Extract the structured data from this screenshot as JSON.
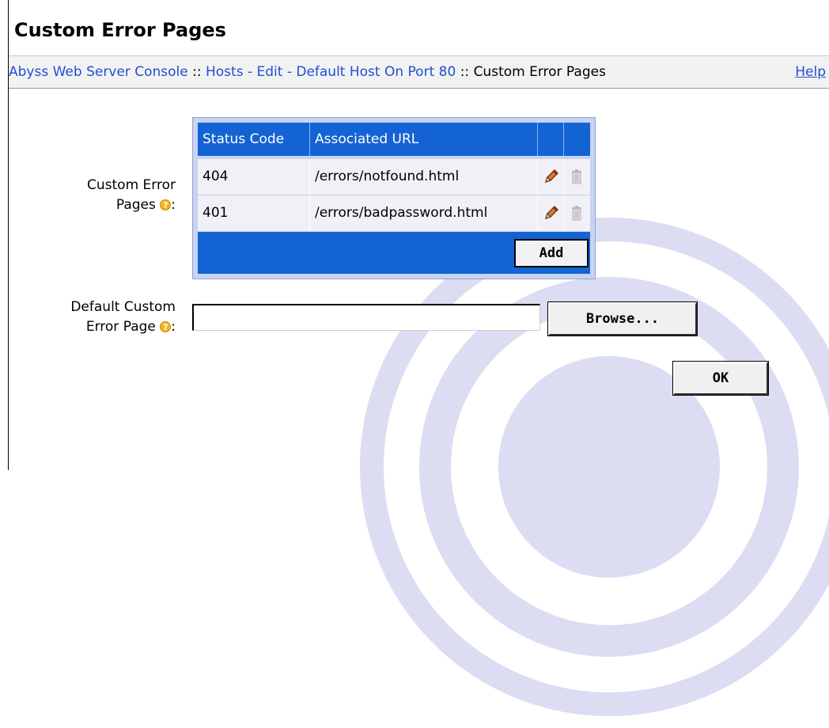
{
  "page": {
    "title": "Custom Error Pages"
  },
  "breadcrumb": {
    "items": [
      "Abyss Web Server Console",
      "Hosts - Edit - Default Host On Port 80"
    ],
    "separator": "::",
    "current": "Custom Error Pages",
    "help": "Help"
  },
  "custom_errors": {
    "label_line1": "Custom Error",
    "label_line2": "Pages",
    "columns": [
      "Status Code",
      "Associated URL"
    ],
    "rows": [
      {
        "status_code": "404",
        "url": "/errors/notfound.html"
      },
      {
        "status_code": "401",
        "url": "/errors/badpassword.html"
      }
    ],
    "add_label": "Add"
  },
  "default_page": {
    "label_line1": "Default Custom",
    "label_line2": "Error Page",
    "value": "",
    "browse_label": "Browse..."
  },
  "ok_label": "OK",
  "help_icon_glyph": "?",
  "colors": {
    "accent": "#1463d4",
    "link": "#1f4fd6",
    "watermark": "#d9d9f2",
    "help_icon": "#f2b51c"
  }
}
